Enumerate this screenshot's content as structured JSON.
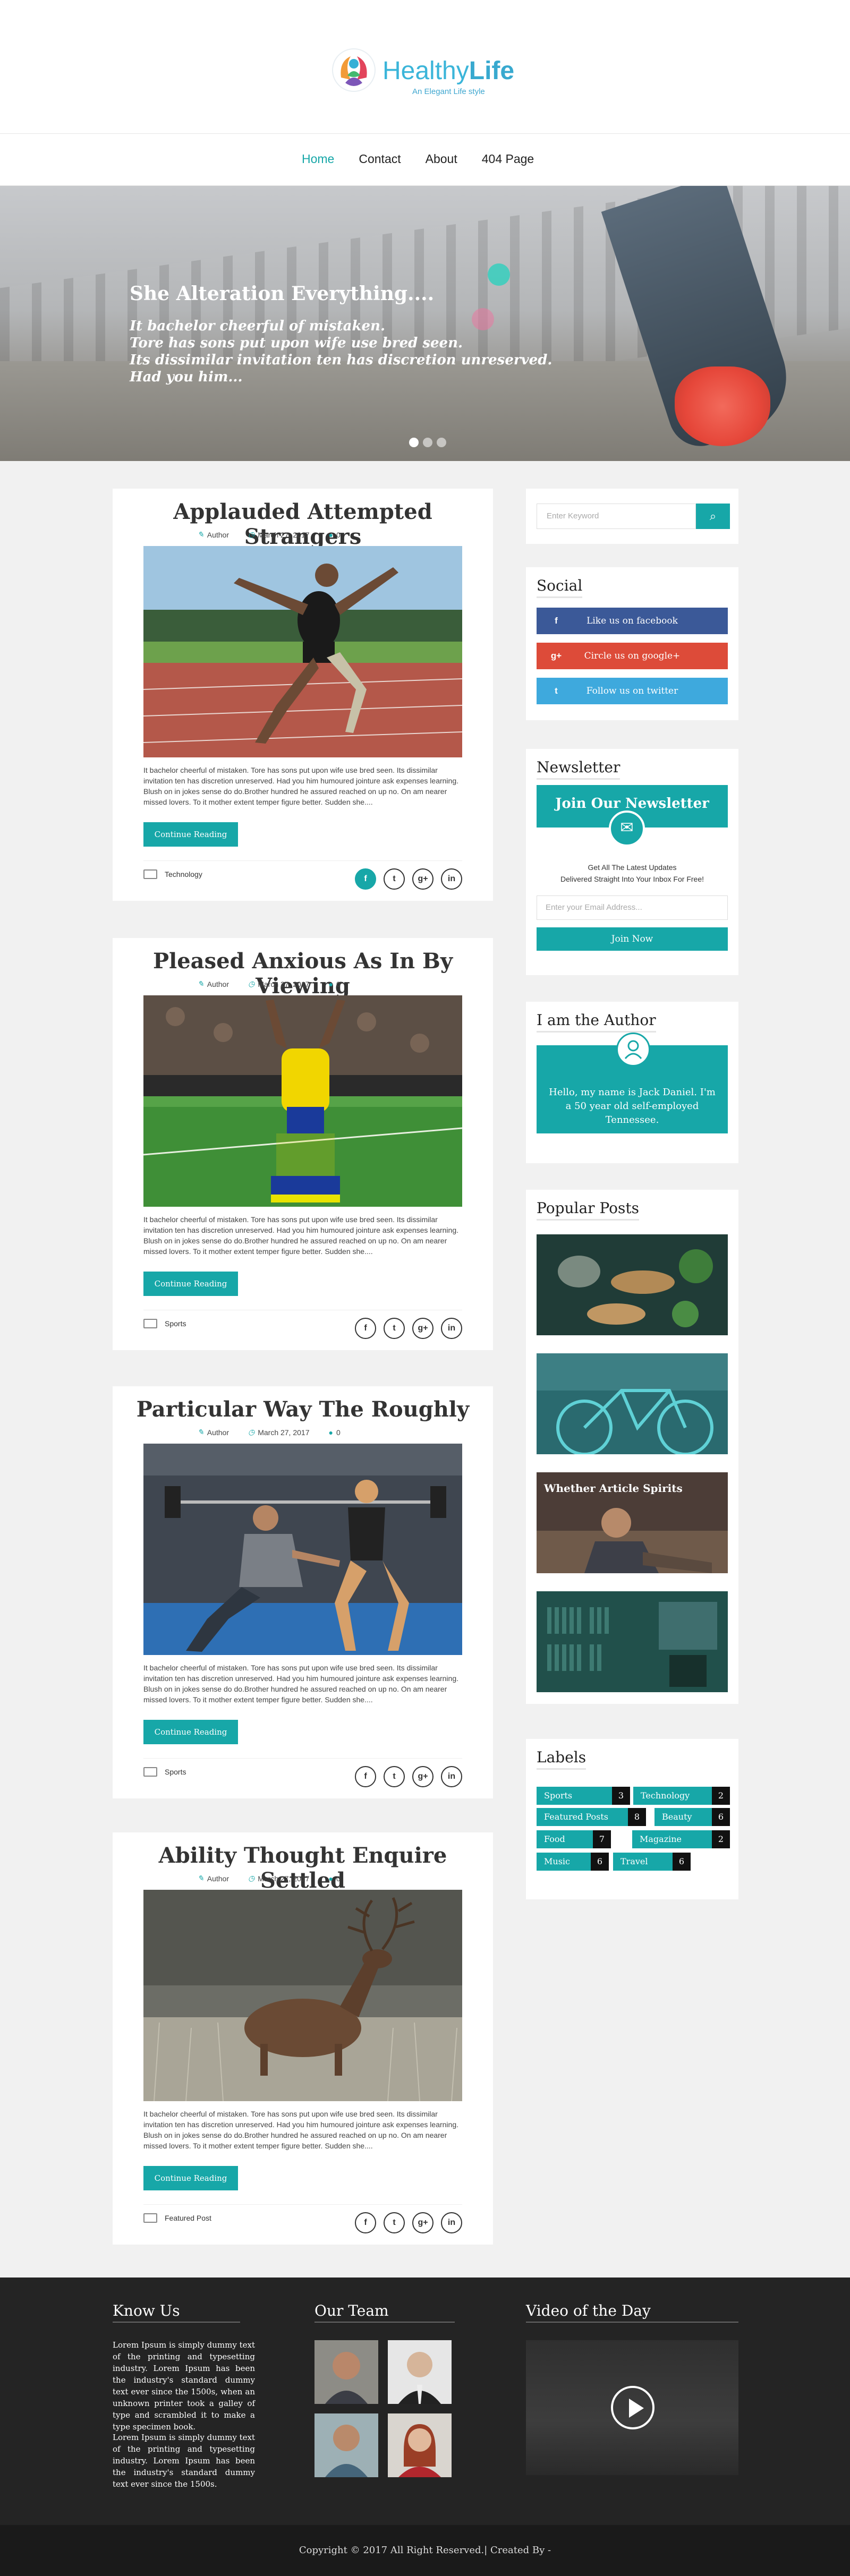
{
  "brand": {
    "name_part1": "Healthy",
    "name_part2": "Life",
    "tagline": "An Elegant Life style"
  },
  "nav": {
    "items": [
      "Home",
      "Contact",
      "About",
      "404 Page"
    ],
    "active": "Home"
  },
  "hero": {
    "title": "She Alteration Everything....",
    "lines": [
      "It bachelor cheerful of mistaken.",
      "Tore has sons put upon wife use bred seen.",
      "Its dissimilar invitation ten has discretion unreserved.",
      "Had you him..."
    ]
  },
  "posts": [
    {
      "title": "Applauded Attempted Strangers",
      "author": "Author",
      "date": "March 27, 2017",
      "comments": "0",
      "excerpt": "It bachelor cheerful of mistaken. Tore has sons put upon wife use bred seen. Its dissimilar invitation ten has discretion unreserved. Had you him humoured jointure ask expenses learning. Blush on in jokes sense do do.Brother hundred he assured reached on up no. On am nearer missed lovers. To it mother extent temper figure better. Sudden she....",
      "button": "Continue Reading",
      "category": "Technology"
    },
    {
      "title": "Pleased Anxious As In By Viewing",
      "author": "Author",
      "date": "March 27, 2017",
      "comments": "0",
      "excerpt": "It bachelor cheerful of mistaken. Tore has sons put upon wife use bred seen. Its dissimilar invitation ten has discretion unreserved. Had you him humoured jointure ask expenses learning. Blush on in jokes sense do do.Brother hundred he assured reached on up no. On am nearer missed lovers. To it mother extent temper figure better. Sudden she....",
      "button": "Continue Reading",
      "category": "Sports"
    },
    {
      "title": "Particular Way The Roughly",
      "author": "Author",
      "date": "March 27, 2017",
      "comments": "0",
      "excerpt": "It bachelor cheerful of mistaken. Tore has sons put upon wife use bred seen. Its dissimilar invitation ten has discretion unreserved. Had you him humoured jointure ask expenses learning. Blush on in jokes sense do do.Brother hundred he assured reached on up no. On am nearer missed lovers. To it mother extent temper figure better. Sudden she....",
      "button": "Continue Reading",
      "category": "Sports"
    },
    {
      "title": "Ability Thought Enquire Settled",
      "author": "Author",
      "date": "March 27, 2017",
      "comments": "0",
      "excerpt": "It bachelor cheerful of mistaken. Tore has sons put upon wife use bred seen. Its dissimilar invitation ten has discretion unreserved. Had you him humoured jointure ask expenses learning. Blush on in jokes sense do do.Brother hundred he assured reached on up no. On am nearer missed lovers. To it mother extent temper figure better. Sudden she....",
      "button": "Continue Reading",
      "category": "Featured Post"
    }
  ],
  "sidebar": {
    "search": {
      "placeholder": "Enter Keyword"
    },
    "social": {
      "title": "Social",
      "facebook": "Like us on facebook",
      "google": "Circle us on google+",
      "twitter": "Follow us on twitter"
    },
    "newsletter": {
      "title": "Newsletter",
      "heading": "Join Our Newsletter",
      "line1": "Get All The Latest Updates",
      "line2": "Delivered Straight Into Your Inbox For Free!",
      "placeholder": "Enter your Email Address...",
      "button": "Join Now"
    },
    "author": {
      "title": "I am the Author",
      "bio": "Hello, my name is Jack Daniel. I'm a 50 year old self-employed Tennessee."
    },
    "popular": {
      "title": "Popular Posts",
      "caption": "Whether Article Spirits"
    },
    "labels": {
      "title": "Labels",
      "items": [
        {
          "name": "Sports",
          "count": "3"
        },
        {
          "name": "Technology",
          "count": "2"
        },
        {
          "name": "Featured Posts",
          "count": "8"
        },
        {
          "name": "Beauty",
          "count": "6"
        },
        {
          "name": "Food",
          "count": "7"
        },
        {
          "name": "Magazine",
          "count": "2"
        },
        {
          "name": "Music",
          "count": "6"
        },
        {
          "name": "Travel",
          "count": "6"
        }
      ]
    }
  },
  "footer": {
    "know_title": "Know Us",
    "know_p1": "Lorem Ipsum is simply dummy text of the printing and typesetting industry. Lorem Ipsum has been the industry's standard dummy text ever since the 1500s, when an unknown printer took a galley of type and scrambled it to make a type specimen book.",
    "know_p2": "Lorem Ipsum is simply dummy text of the printing and typesetting industry. Lorem Ipsum has been the industry's standard dummy text ever since the 1500s.",
    "team_title": "Our Team",
    "video_title": "Video of the Day",
    "copyright": "Copyright © 2017 All Right Reserved.| Created By -"
  },
  "colors": {
    "accent": "#17a7a8",
    "facebook": "#3b5998",
    "google": "#dd4b39",
    "twitter": "#3ea9dd",
    "footer_bg": "#242424"
  },
  "icons": {
    "author": "pencil-icon",
    "date": "clock-icon",
    "comments": "comment-icon",
    "category": "folder-icon",
    "search": "search-icon",
    "newsletter": "envelope-icon",
    "video": "play-icon"
  }
}
